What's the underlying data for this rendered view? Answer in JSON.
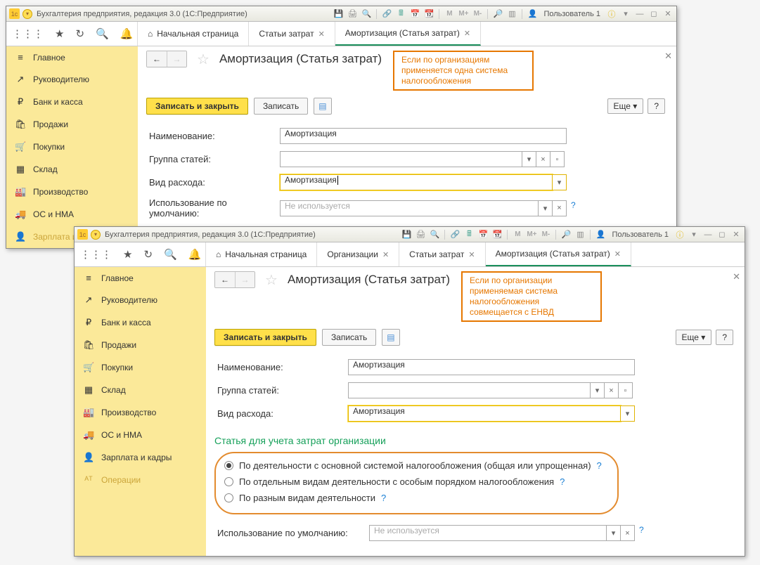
{
  "titlebar": {
    "text": "Бухгалтерия предприятия, редакция 3.0  (1С:Предприятие)",
    "user": "Пользователь 1",
    "memo1": "М",
    "memo2": "М+",
    "memo3": "М-"
  },
  "navleft": {
    "home": "Начальная страница"
  },
  "sidebar": [
    {
      "icon": "≡",
      "label": "Главное"
    },
    {
      "icon": "↗",
      "label": "Руководителю"
    },
    {
      "icon": "₽",
      "label": "Банк и касса"
    },
    {
      "icon": "🛍",
      "label": "Продажи"
    },
    {
      "icon": "🛒",
      "label": "Покупки"
    },
    {
      "icon": "▦",
      "label": "Склад"
    },
    {
      "icon": "🏭",
      "label": "Производство"
    },
    {
      "icon": "🚚",
      "label": "ОС и НМА"
    },
    {
      "icon": "👤",
      "label": "Зарплата и кадры"
    }
  ],
  "sidebar2_extra": {
    "icon": "ᴬᵀ",
    "label": "Операции"
  },
  "win1": {
    "tabs": [
      {
        "label": "Статьи затрат",
        "active": false
      },
      {
        "label": "Амортизация (Статья затрат)",
        "active": true
      }
    ],
    "title": "Амортизация (Статья затрат)",
    "callout": "Если по организациям применяется одна система налогообложения",
    "actions": {
      "primary": "Записать и закрыть",
      "write": "Записать",
      "more": "Еще",
      "help": "?"
    },
    "fields": {
      "name_label": "Наименование:",
      "name_value": "Амортизация",
      "group_label": "Группа статей:",
      "group_value": "",
      "type_label": "Вид расхода:",
      "type_value": "Амортизация",
      "default_label": "Использование по умолчанию:",
      "default_value": "Не используется"
    }
  },
  "win2": {
    "tabs": [
      {
        "label": "Организации",
        "active": false
      },
      {
        "label": "Статьи затрат",
        "active": false
      },
      {
        "label": "Амортизация (Статья затрат)",
        "active": true
      }
    ],
    "title": "Амортизация (Статья затрат)",
    "callout": "Если по организации применяемая система налогообложения совмещается с ЕНВД",
    "actions": {
      "primary": "Записать и закрыть",
      "write": "Записать",
      "more": "Еще",
      "help": "?"
    },
    "fields": {
      "name_label": "Наименование:",
      "name_value": "Амортизация",
      "group_label": "Группа статей:",
      "group_value": "",
      "type_label": "Вид расхода:",
      "type_value": "Амортизация",
      "default_label": "Использование по умолчанию:",
      "default_value": "Не используется"
    },
    "section": {
      "title": "Статья для учета затрат организации",
      "opt1": "По деятельности с основной системой налогообложения (общая или упрощенная)",
      "opt2": "По отдельным видам деятельности с особым порядком налогообложения",
      "opt3": "По разным видам деятельности"
    }
  }
}
